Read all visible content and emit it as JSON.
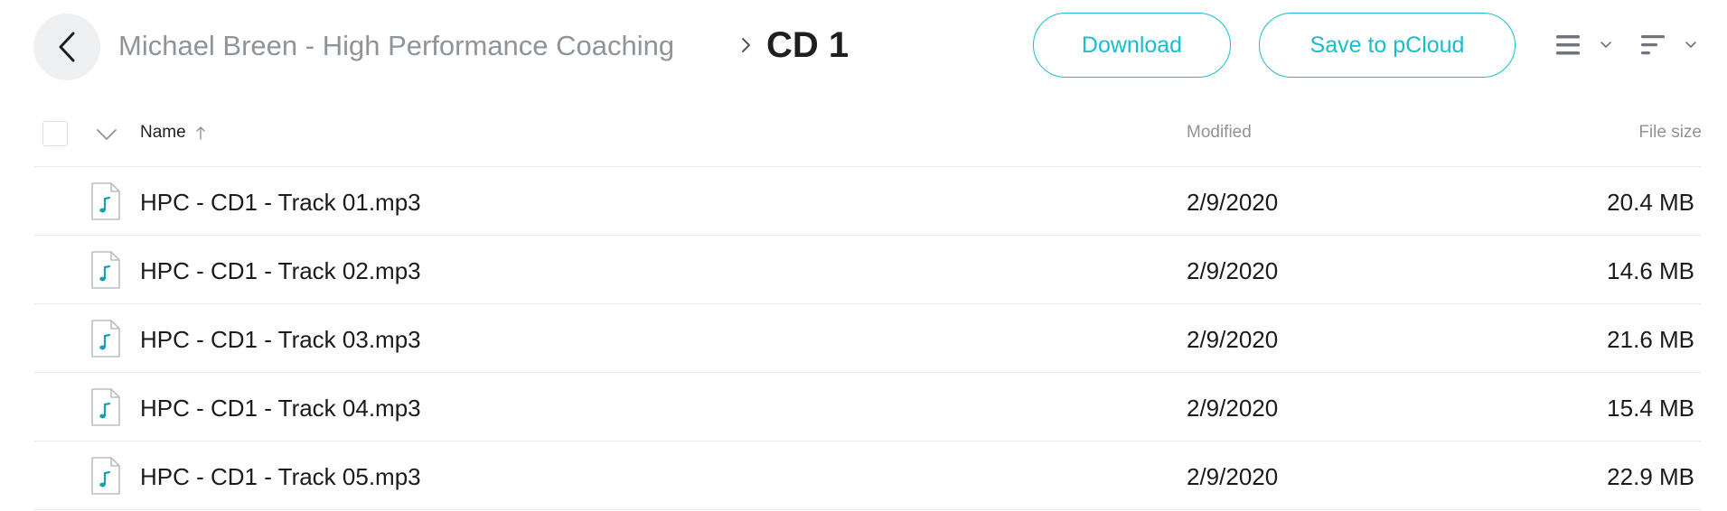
{
  "breadcrumb": {
    "parent": "Michael Breen - High Performance Coaching",
    "separator": ">",
    "current": "CD 1"
  },
  "actions": {
    "download_label": "Download",
    "save_label": "Save to pCloud"
  },
  "icons": {
    "back": "chevron-left-icon",
    "view": "list-view-icon",
    "sort": "sort-icon",
    "file": "audio-file-icon"
  },
  "colors": {
    "accent": "#17bed0",
    "muted_text": "#8e949a",
    "back_bg": "#eef0f2",
    "divider": "#e9ebed"
  },
  "table": {
    "columns": {
      "name": "Name",
      "modified": "Modified",
      "size": "File size"
    },
    "sort": {
      "column": "Name",
      "direction": "ascending"
    },
    "rows": [
      {
        "name": "HPC - CD1 - Track 01.mp3",
        "modified": "2/9/2020",
        "size": "20.4 MB"
      },
      {
        "name": "HPC - CD1 - Track 02.mp3",
        "modified": "2/9/2020",
        "size": "14.6 MB"
      },
      {
        "name": "HPC - CD1 - Track 03.mp3",
        "modified": "2/9/2020",
        "size": "21.6 MB"
      },
      {
        "name": "HPC - CD1 - Track 04.mp3",
        "modified": "2/9/2020",
        "size": "15.4 MB"
      },
      {
        "name": "HPC - CD1 - Track 05.mp3",
        "modified": "2/9/2020",
        "size": "22.9 MB"
      }
    ]
  }
}
